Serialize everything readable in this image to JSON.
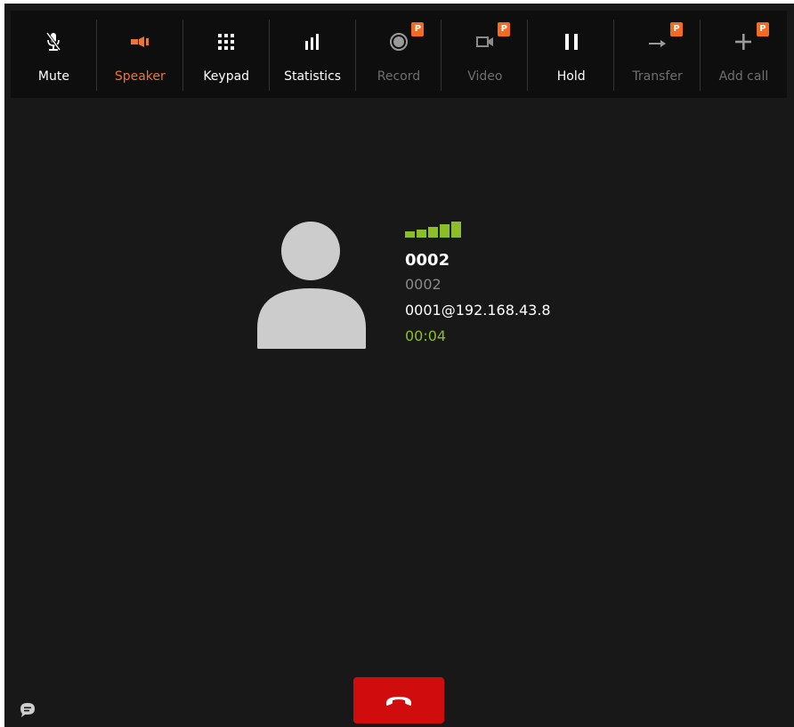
{
  "toolbar": {
    "buttons": [
      {
        "id": "mute",
        "label": "Mute",
        "icon": "mic-off-icon",
        "state": "normal",
        "pro": false
      },
      {
        "id": "speaker",
        "label": "Speaker",
        "icon": "speaker-icon",
        "state": "active",
        "pro": false
      },
      {
        "id": "keypad",
        "label": "Keypad",
        "icon": "keypad-icon",
        "state": "normal",
        "pro": false
      },
      {
        "id": "statistics",
        "label": "Statistics",
        "icon": "bar-chart-icon",
        "state": "normal",
        "pro": false
      },
      {
        "id": "record",
        "label": "Record",
        "icon": "record-icon",
        "state": "disabled",
        "pro": true
      },
      {
        "id": "video",
        "label": "Video",
        "icon": "video-camera-icon",
        "state": "disabled",
        "pro": true
      },
      {
        "id": "hold",
        "label": "Hold",
        "icon": "pause-icon",
        "state": "normal",
        "pro": false
      },
      {
        "id": "transfer",
        "label": "Transfer",
        "icon": "arrow-right-icon",
        "state": "disabled",
        "pro": true
      },
      {
        "id": "add_call",
        "label": "Add call",
        "icon": "plus-icon",
        "state": "disabled",
        "pro": true
      }
    ],
    "pro_badge_text": "P"
  },
  "call": {
    "name": "0002",
    "number": "0002",
    "sip_address": "0001@192.168.43.8",
    "duration": "00:04",
    "signal_bars_lit": 5,
    "signal_bars_total": 5
  },
  "colors": {
    "background": "#181818",
    "toolbar": "#0e0e0e",
    "accent_orange": "#f07330",
    "signal_green": "#8cbf26",
    "hangup_red": "#d10c0c",
    "disabled_text": "#6e6e6e"
  }
}
